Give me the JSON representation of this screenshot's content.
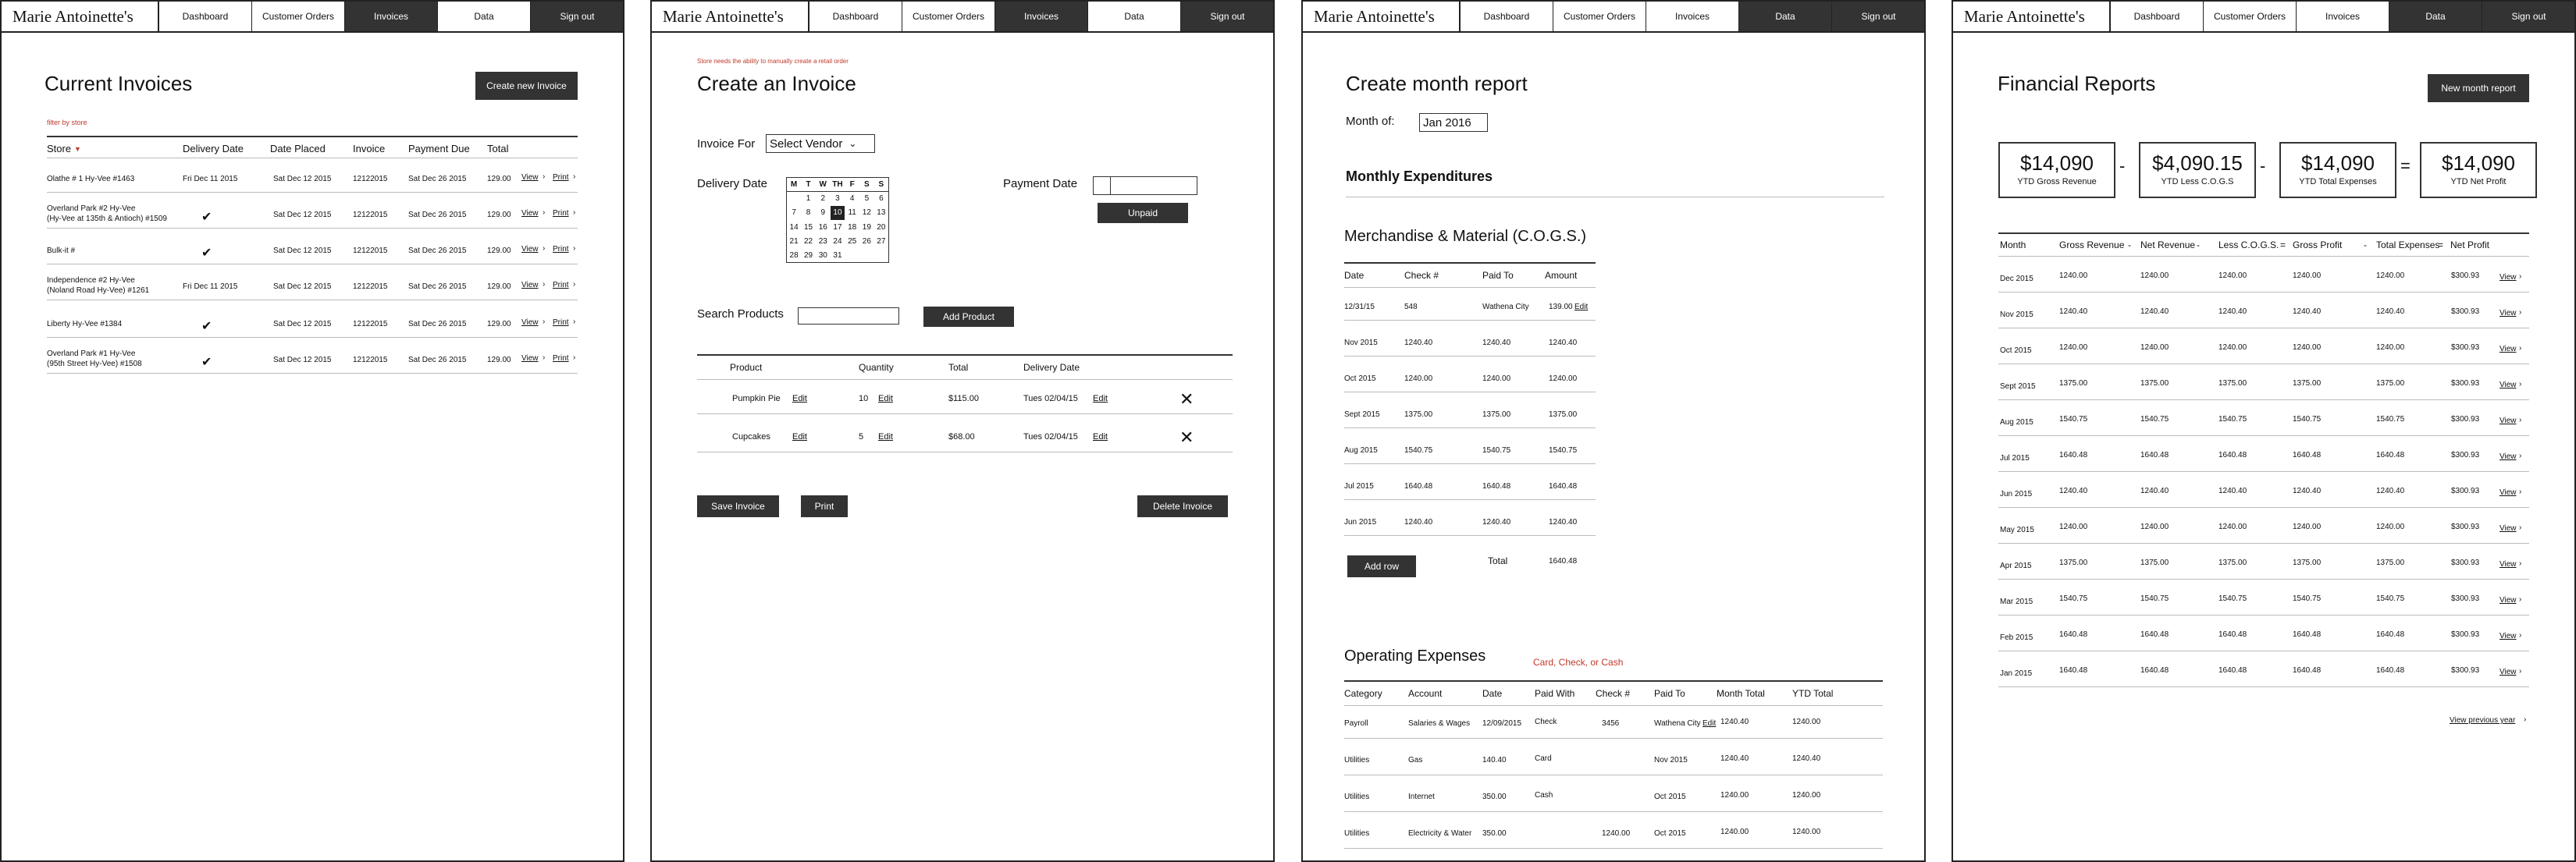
{
  "nav": {
    "brand": "Marie Antoinette's",
    "items": [
      "Dashboard",
      "Customer Orders",
      "Invoices",
      "Data",
      "Sign out"
    ]
  },
  "panel1": {
    "title": "Current Invoices",
    "create_btn": "Create new Invoice",
    "filter_note": "filter by store",
    "headers": [
      "Store",
      "Delivery Date",
      "Date Placed",
      "Invoice",
      "Payment Due",
      "Total"
    ],
    "rows": [
      {
        "store": "Olathe # 1 Hy-Vee #1463",
        "store2": "",
        "delivery": "Fri Dec 11 2015",
        "placed": "Sat Dec 12 2015",
        "invoice": "12122015",
        "due": "Sat Dec 26 2015",
        "total": "129.00",
        "check": false
      },
      {
        "store": "Overland Park #2 Hy-Vee",
        "store2": "(Hy-Vee at 135th & Antioch) #1509",
        "delivery": "",
        "placed": "Sat Dec 12 2015",
        "invoice": "12122015",
        "due": "Sat Dec 26 2015",
        "total": "129.00",
        "check": true
      },
      {
        "store": "Bulk-it #",
        "store2": "",
        "delivery": "",
        "placed": "Sat Dec 12 2015",
        "invoice": "12122015",
        "due": "Sat Dec 26 2015",
        "total": "129.00",
        "check": true
      },
      {
        "store": "Independence #2 Hy-Vee",
        "store2": "(Noland Road Hy-Vee) #1261",
        "delivery": "Fri Dec 11 2015",
        "placed": "Sat Dec 12 2015",
        "invoice": "12122015",
        "due": "Sat Dec 26 2015",
        "total": "129.00",
        "check": false
      },
      {
        "store": "Liberty Hy-Vee #1384",
        "store2": "",
        "delivery": "",
        "placed": "Sat Dec 12 2015",
        "invoice": "12122015",
        "due": "Sat Dec 26 2015",
        "total": "129.00",
        "check": true
      },
      {
        "store": "Overland Park #1 Hy-Vee",
        "store2": "(95th Street Hy-Vee) #1508",
        "delivery": "",
        "placed": "Sat Dec 12 2015",
        "invoice": "12122015",
        "due": "Sat Dec 26 2015",
        "total": "129.00",
        "check": true
      }
    ],
    "view": "View",
    "print": "Print"
  },
  "panel2": {
    "note": "Store needs the ability to manually create a retail order",
    "title": "Create an Invoice",
    "invoice_for": "Invoice For",
    "vendor_select": "Select Vendor",
    "delivery_date": "Delivery Date",
    "payment_date": "Payment Date",
    "unpaid": "Unpaid",
    "cal_days": [
      "M",
      "T",
      "W",
      "TH",
      "F",
      "S",
      "S"
    ],
    "cal_rows": [
      [
        "",
        "",
        "",
        "",
        "",
        "",
        ""
      ],
      [
        "",
        "1",
        "2",
        "3",
        "4",
        "5",
        "6"
      ],
      [
        "7",
        "8",
        "9",
        "10",
        "11",
        "12",
        "13"
      ],
      [
        "14",
        "15",
        "16",
        "17",
        "18",
        "19",
        "20"
      ],
      [
        "21",
        "22",
        "23",
        "24",
        "25",
        "26",
        "27"
      ],
      [
        "28",
        "29",
        "30",
        "31",
        "",
        "",
        ""
      ]
    ],
    "search_products": "Search Products",
    "add_product": "Add Product",
    "headers": [
      "Product",
      "Quantity",
      "Total",
      "Delivery Date"
    ],
    "rows": [
      {
        "product": "Pumpkin Pie",
        "qty": "10",
        "total": "$115.00",
        "date": "Tues 02/04/15"
      },
      {
        "product": "Cupcakes",
        "qty": "5",
        "total": "$68.00",
        "date": "Tues 02/04/15"
      }
    ],
    "edit": "Edit",
    "save": "Save Invoice",
    "print": "Print",
    "delete": "Delete Invoice"
  },
  "panel3": {
    "title": "Create month report",
    "month_of": "Month of:",
    "month_value": "Jan 2016",
    "monthly_exp": "Monthly Expenditures",
    "merch_title": "Merchandise & Material (C.O.G.S.)",
    "merch_headers": [
      "Date",
      "Check #",
      "Paid To",
      "Amount"
    ],
    "merch_rows": [
      {
        "date": "12/31/15",
        "check": "548",
        "paid": "Wathena City",
        "amount": "139.00",
        "edit": "Edit"
      },
      {
        "date": "Nov 2015",
        "check": "1240.40",
        "paid": "1240.40",
        "amount": "1240.40",
        "edit": ""
      },
      {
        "date": "Oct 2015",
        "check": "1240.00",
        "paid": "1240.00",
        "amount": "1240.00",
        "edit": ""
      },
      {
        "date": "Sept 2015",
        "check": "1375.00",
        "paid": "1375.00",
        "amount": "1375.00",
        "edit": ""
      },
      {
        "date": "Aug 2015",
        "check": "1540.75",
        "paid": "1540.75",
        "amount": "1540.75",
        "edit": ""
      },
      {
        "date": "Jul 2015",
        "check": "1640.48",
        "paid": "1640.48",
        "amount": "1640.48",
        "edit": ""
      },
      {
        "date": "Jun 2015",
        "check": "1240.40",
        "paid": "1240.40",
        "amount": "1240.40",
        "edit": ""
      }
    ],
    "add_row": "Add row",
    "total_label": "Total",
    "total_value": "1640.48",
    "op_title": "Operating Expenses",
    "op_note": "Card, Check, or Cash",
    "op_headers": [
      "Category",
      "Account",
      "Date",
      "Paid With",
      "Check #",
      "Paid To",
      "Month Total",
      "YTD Total"
    ],
    "op_rows": [
      {
        "cat": "Payroll",
        "acc": "Salaries & Wages",
        "date": "12/09/2015",
        "with": "Check",
        "check": "3456",
        "paid": "Wathena City",
        "edit": "Edit",
        "month": "1240.40",
        "ytd": "1240.00"
      },
      {
        "cat": "Utilities",
        "acc": "Gas",
        "date": "140.40",
        "with": "Card",
        "check": "",
        "paid": "Nov 2015",
        "edit": "",
        "month": "1240.40",
        "ytd": "1240.40"
      },
      {
        "cat": "Utilities",
        "acc": "Internet",
        "date": "350.00",
        "with": "Cash",
        "check": "",
        "paid": "Oct 2015",
        "edit": "",
        "month": "1240.00",
        "ytd": "1240.00"
      },
      {
        "cat": "Utilities",
        "acc": "Electricity & Water",
        "date": "350.00",
        "with": "",
        "check": "1240.00",
        "paid": "Oct 2015",
        "edit": "",
        "month": "1240.00",
        "ytd": "1240.00"
      }
    ]
  },
  "panel4": {
    "title": "Financial Reports",
    "new_btn": "New month report",
    "cards": [
      {
        "value": "$14,090",
        "label": "YTD Gross Revenue"
      },
      {
        "value": "$4,090.15",
        "label": "YTD Less C.O.G.S"
      },
      {
        "value": "$14,090",
        "label": "YTD Total Expenses"
      },
      {
        "value": "$14,090",
        "label": "YTD Net Profit"
      }
    ],
    "ops": [
      "-",
      "-",
      "="
    ],
    "headers": [
      "Month",
      "Gross Revenue",
      "-",
      "Net Revenue",
      "-",
      "Less C.O.G.S.",
      "=",
      "Gross Profit",
      "-",
      "Total Expenses",
      "=",
      "Net Profit"
    ],
    "rows": [
      [
        "Dec 2015",
        "1240.00",
        "1240.00",
        "1240.00",
        "1240.00",
        "1240.00",
        "$300.93"
      ],
      [
        "Nov 2015",
        "1240.40",
        "1240.40",
        "1240.40",
        "1240.40",
        "1240.40",
        "$300.93"
      ],
      [
        "Oct 2015",
        "1240.00",
        "1240.00",
        "1240.00",
        "1240.00",
        "1240.00",
        "$300.93"
      ],
      [
        "Sept 2015",
        "1375.00",
        "1375.00",
        "1375.00",
        "1375.00",
        "1375.00",
        "$300.93"
      ],
      [
        "Aug 2015",
        "1540.75",
        "1540.75",
        "1540.75",
        "1540.75",
        "1540.75",
        "$300.93"
      ],
      [
        "Jul 2015",
        "1640.48",
        "1640.48",
        "1640.48",
        "1640.48",
        "1640.48",
        "$300.93"
      ],
      [
        "Jun 2015",
        "1240.40",
        "1240.40",
        "1240.40",
        "1240.40",
        "1240.40",
        "$300.93"
      ],
      [
        "May 2015",
        "1240.00",
        "1240.00",
        "1240.00",
        "1240.00",
        "1240.00",
        "$300.93"
      ],
      [
        "Apr 2015",
        "1375.00",
        "1375.00",
        "1375.00",
        "1375.00",
        "1375.00",
        "$300.93"
      ],
      [
        "Mar 2015",
        "1540.75",
        "1540.75",
        "1540.75",
        "1540.75",
        "1540.75",
        "$300.93"
      ],
      [
        "Feb 2015",
        "1640.48",
        "1640.48",
        "1640.48",
        "1640.48",
        "1640.48",
        "$300.93"
      ],
      [
        "Jan 2015",
        "1640.48",
        "1640.48",
        "1640.48",
        "1640.48",
        "1640.48",
        "$300.93"
      ]
    ],
    "view": "View",
    "prev_year": "View previous year"
  }
}
